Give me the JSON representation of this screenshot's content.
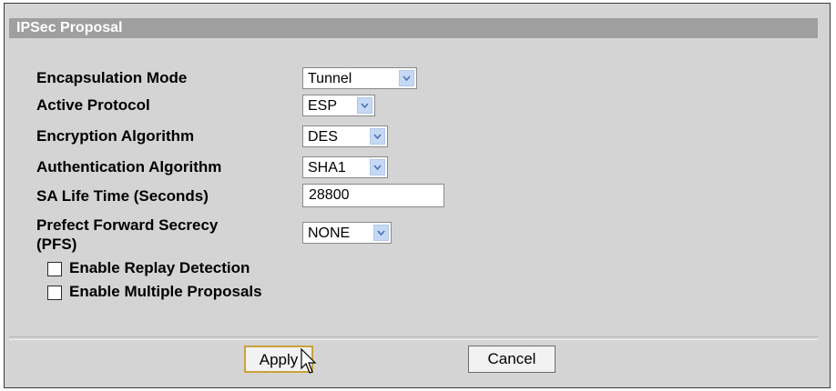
{
  "panel": {
    "title": "IPSec Proposal"
  },
  "fields": {
    "encapsulation": {
      "label": "Encapsulation Mode",
      "value": "Tunnel"
    },
    "protocol": {
      "label": "Active Protocol",
      "value": "ESP"
    },
    "encryption": {
      "label": "Encryption Algorithm",
      "value": "DES"
    },
    "authentication": {
      "label": "Authentication Algorithm",
      "value": "SHA1"
    },
    "sa_life": {
      "label": "SA Life Time (Seconds)",
      "value": "28800"
    },
    "pfs": {
      "label_line1": "Prefect Forward Secrecy",
      "label_line2": "(PFS)",
      "value": "NONE"
    }
  },
  "checkboxes": {
    "replay": {
      "label": "Enable Replay Detection",
      "checked": false
    },
    "multiple": {
      "label": "Enable Multiple Proposals",
      "checked": false
    }
  },
  "buttons": {
    "apply": "Apply",
    "cancel": "Cancel"
  },
  "icons": {
    "dropdown": "chevron-down-icon",
    "pointer": "mouse-pointer-icon"
  },
  "colors": {
    "header_bg": "#9f9f9f",
    "panel_bg": "#d4d4d4",
    "dropdown_arrow_bg": "#c6d9f4"
  }
}
